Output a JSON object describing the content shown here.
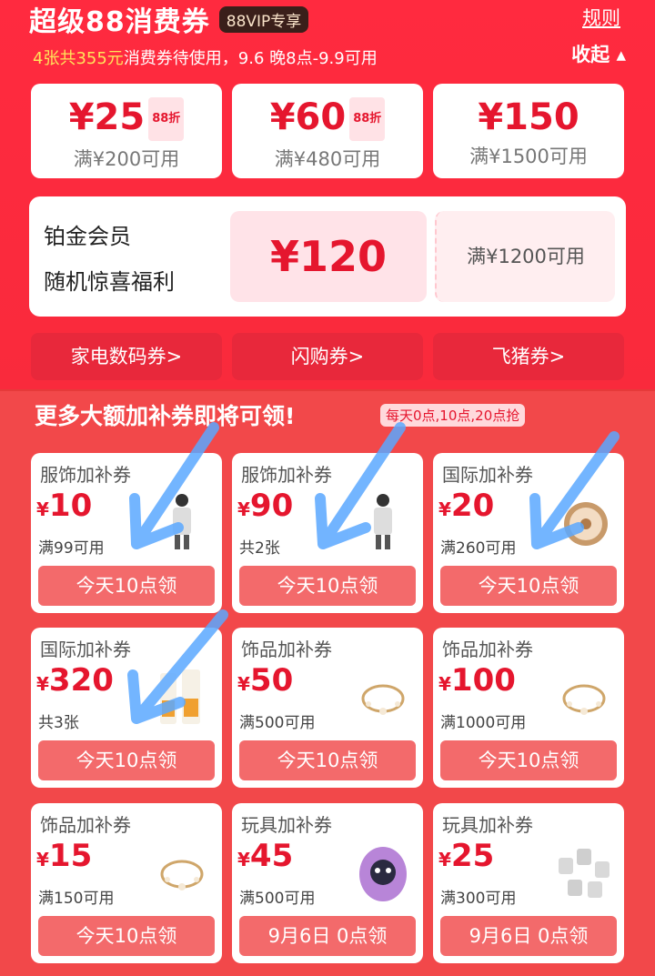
{
  "header": {
    "title": "超级88消费券",
    "vip_tag": "88VIP专享",
    "rules_link": "规则",
    "subtitle_count": "4张共355元",
    "subtitle_rest": "消费券待使用，9.6 晚8点-9.9可用",
    "collapse_label": "收起 ▴"
  },
  "coupons": [
    {
      "amount": "¥25",
      "tag": "88折",
      "condition": "满¥200可用"
    },
    {
      "amount": "¥60",
      "tag": "88折",
      "condition": "满¥480可用"
    },
    {
      "amount": "¥150",
      "tag": "",
      "condition": "满¥1500可用"
    }
  ],
  "platinum": {
    "line1": "铂金会员",
    "line2": "随机惊喜福利",
    "amount": "¥120",
    "condition": "满¥1200可用"
  },
  "categories": [
    "家电数码券>",
    "闪购券>",
    "飞猪券>"
  ],
  "more": {
    "title": "更多大额加补券即将可领!",
    "schedule": "每天0点,10点,20点抢"
  },
  "cards": [
    {
      "title": "服饰加补券",
      "currency": "¥",
      "value": "10",
      "condition": "满99可用",
      "button": "今天10点领",
      "thumb": "person-clothing-icon"
    },
    {
      "title": "服饰加补券",
      "currency": "¥",
      "value": "90",
      "condition": "共2张",
      "button": "今天10点领",
      "thumb": "person-clothing-icon"
    },
    {
      "title": "国际加补券",
      "currency": "¥",
      "value": "20",
      "condition": "满260可用",
      "button": "今天10点领",
      "thumb": "cushion-compact-icon"
    },
    {
      "title": "国际加补券",
      "currency": "¥",
      "value": "320",
      "condition": "共3张",
      "button": "今天10点领",
      "thumb": "sunscreen-icon"
    },
    {
      "title": "饰品加补券",
      "currency": "¥",
      "value": "50",
      "condition": "满500可用",
      "button": "今天10点领",
      "thumb": "bracelet-icon"
    },
    {
      "title": "饰品加补券",
      "currency": "¥",
      "value": "100",
      "condition": "满1000可用",
      "button": "今天10点领",
      "thumb": "bracelet-icon"
    },
    {
      "title": "饰品加补券",
      "currency": "¥",
      "value": "15",
      "condition": "满150可用",
      "button": "今天10点领",
      "thumb": "bracelet-icon"
    },
    {
      "title": "玩具加补券",
      "currency": "¥",
      "value": "45",
      "condition": "满500可用",
      "button": "9月6日 0点领",
      "thumb": "toy-egg-icon"
    },
    {
      "title": "玩具加补券",
      "currency": "¥",
      "value": "25",
      "condition": "满300可用",
      "button": "9月6日 0点领",
      "thumb": "toy-figures-icon"
    }
  ],
  "colors": {
    "accent": "#e5162e",
    "background": "#f2484a",
    "button": "#f36a6b"
  }
}
